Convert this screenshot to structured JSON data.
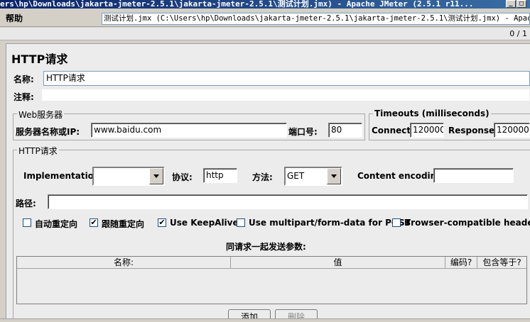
{
  "window": {
    "title": "ers\\hp\\Downloads\\jakarta-jmeter-2.5.1\\jakarta-jmeter-2.5.1\\测试计划.jmx) - Apache JMeter (2.5.1 r11...",
    "minimize_glyph": "_",
    "maximize_glyph": "□"
  },
  "menu": {
    "help": "帮助"
  },
  "path_display": "测试计划.jmx (C:\\Users\\hp\\Downloads\\jakarta-jmeter-2.5.1\\jakarta-jmeter-2.5.1\\测试计划.jmx) - Apache",
  "counter": "0 / 1",
  "panel": {
    "title": "HTTP请求",
    "name_label": "名称:",
    "name_value": "HTTP请求",
    "comment_label": "注释:",
    "comment_value": "",
    "web_server": {
      "legend": "Web服务器",
      "server_label": "服务器名称或IP:",
      "server_value": "www.baidu.com",
      "port_label": "端口号:",
      "port_value": "80"
    },
    "timeouts": {
      "legend": "Timeouts (milliseconds)",
      "connect_label": "Connect:",
      "connect_value": "120000",
      "response_label": "Response:",
      "response_value": "120000"
    },
    "http_request": {
      "legend": "HTTP请求",
      "implementation_label": "Implementation:",
      "implementation_value": "",
      "protocol_label": "协议:",
      "protocol_value": "http",
      "method_label": "方法:",
      "method_value": "GET",
      "encoding_label": "Content encoding:",
      "encoding_value": "",
      "path_label": "路径:",
      "path_value": "",
      "options": [
        {
          "label": "自动重定向",
          "checked": false
        },
        {
          "label": "跟随重定向",
          "checked": true
        },
        {
          "label": "Use KeepAlive",
          "checked": true
        },
        {
          "label": "Use multipart/form-data for POST",
          "checked": false
        },
        {
          "label": "Browser-compatible headers",
          "checked": false
        }
      ],
      "params_title": "同请求一起发送参数:",
      "columns": [
        "名称:",
        "值",
        "编码?",
        "包含等于?"
      ],
      "add_button": "添加",
      "delete_button": "删除"
    }
  }
}
